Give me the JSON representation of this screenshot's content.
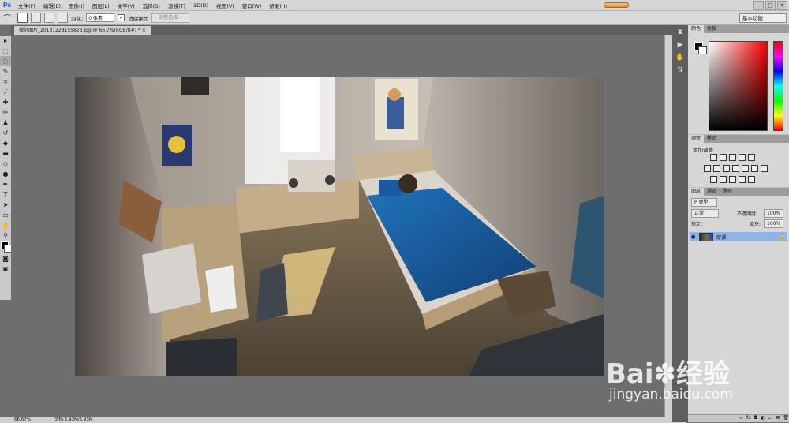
{
  "app": {
    "logo": "Ps",
    "menus": [
      "文件(F)",
      "编辑(E)",
      "图像(I)",
      "图层(L)",
      "文字(Y)",
      "选择(S)",
      "滤镜(T)",
      "3D(D)",
      "视图(V)",
      "窗口(W)",
      "帮助(H)"
    ],
    "window_buttons": [
      "—",
      "▢",
      "✕"
    ]
  },
  "options_bar": {
    "feather_label": "羽化:",
    "feather_value": "0 像素",
    "antialias_label": "消除锯齿",
    "refine_edge_button": "调整边缘...",
    "workspace": "基本功能"
  },
  "document": {
    "tab_title": "微信图片_20181228155823.jpg @ 66.7%(RGB/8#) *",
    "close_glyph": "×"
  },
  "status": {
    "zoom": "66.67%",
    "doc_size": "文档:5.93M/5.93M"
  },
  "panels": {
    "color_tabs": [
      "颜色",
      "色板"
    ],
    "adjust_tabs": [
      "调整",
      "样式"
    ],
    "adjust_title": "添加调整",
    "layers_tabs": [
      "图层",
      "通道",
      "路径"
    ],
    "kind_filter": "P 类型",
    "blend_mode": "正常",
    "opacity_label": "不透明度:",
    "opacity_value": "100%",
    "lock_label": "锁定:",
    "fill_label": "填充:",
    "fill_value": "100%",
    "layer_name": "背景"
  },
  "watermark": {
    "brand": "Bai",
    "brand_cn": "经验",
    "url": "jingyan.baidu.com"
  },
  "colors": {
    "accent": "#2a62c9",
    "selected_layer": "#8fb4e9",
    "blanket": "#1a5f9e",
    "floor": "#8c7a5c"
  }
}
